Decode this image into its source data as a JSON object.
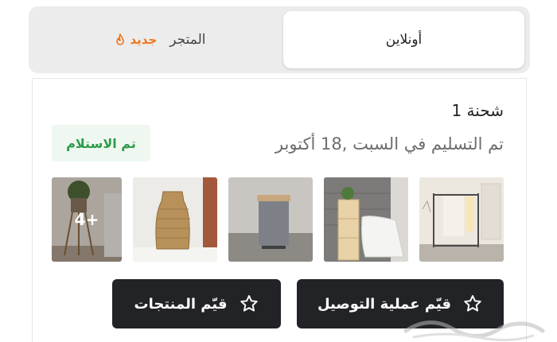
{
  "tabs": {
    "online_label": "أونلاين",
    "store_label": "المتجر",
    "new_badge": "جديد",
    "new_badge_icon": "flame-icon"
  },
  "shipment": {
    "title": "شحنة 1",
    "delivery_text": "تم التسليم في السبت ,18 أكتوبر",
    "status": "تم الاستلام",
    "more_count": "+4",
    "thumbnails": [
      "clothes-rack-image",
      "bathtub-shelf-image",
      "trash-bin-image",
      "woven-vase-image",
      "plant-stand-image"
    ]
  },
  "actions": {
    "rate_delivery": "قيّم عملية التوصيل",
    "rate_products": "قيّم المنتجات",
    "icon": "star-outline-icon"
  },
  "colors": {
    "accent_orange": "#f0751b",
    "status_green": "#2d9b4b",
    "button_dark": "#222326"
  }
}
